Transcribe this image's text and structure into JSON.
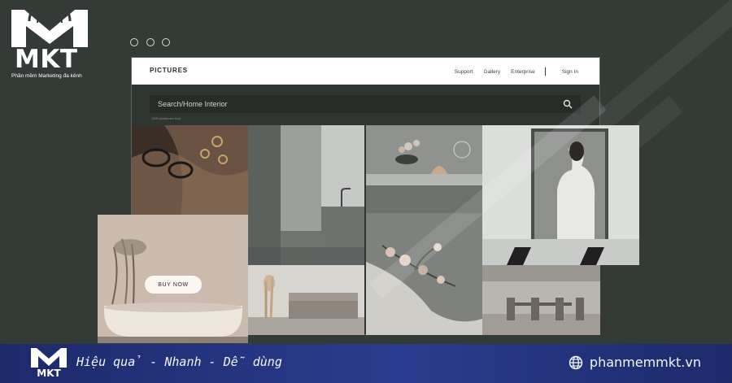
{
  "brand": {
    "logo_text": "MKT",
    "logo_tagline": "Phần mềm Marketing đa kênh",
    "slogan": "Hiệu quả - Nhanh - Dễ dùng",
    "website": "phanmemmkt.vn"
  },
  "watermark": "MKT",
  "site": {
    "brand": "PICTURES",
    "nav": [
      "Support",
      "Gallery",
      "Enterprise"
    ],
    "sign_in": "Sign In",
    "search_value": "Search/Home Interior",
    "search_hint": "100% photos new food"
  },
  "cta": {
    "buy_now": "BUY NOW"
  },
  "colors": {
    "background": "#343b37",
    "banner": "#24338a",
    "accent_white": "#ffffff"
  },
  "icons": [
    "search-icon",
    "globe-icon",
    "window-dot"
  ]
}
